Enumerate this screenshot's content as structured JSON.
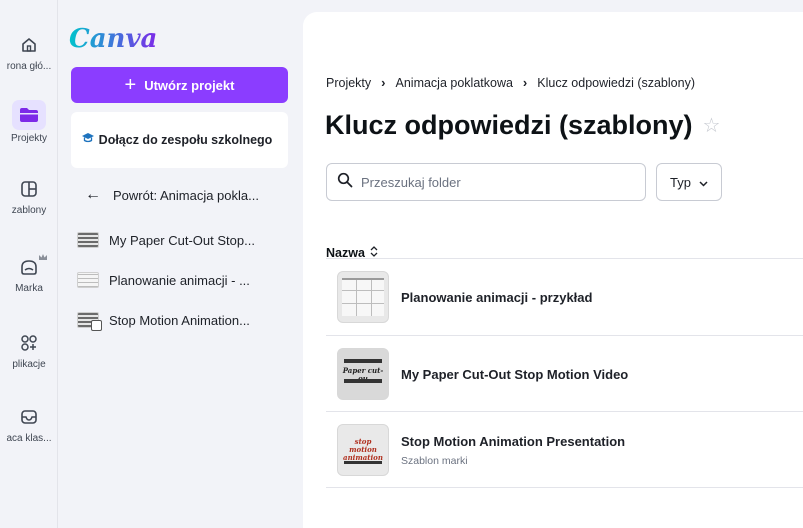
{
  "rail": {
    "items": [
      {
        "label": "rona głó...",
        "icon": "home-icon"
      },
      {
        "label": "Projekty",
        "icon": "folder-icon"
      },
      {
        "label": "zablony",
        "icon": "template-icon"
      },
      {
        "label": "Marka",
        "icon": "brand-icon"
      },
      {
        "label": "plikacje",
        "icon": "apps-icon"
      },
      {
        "label": "aca klas...",
        "icon": "classwork-icon"
      }
    ]
  },
  "sidebar": {
    "logo": "Canva",
    "create_button": "Utwórz projekt",
    "join_card": "Dołącz do zespołu szkolnego",
    "back_link": "Powrót: Animacja pokla...",
    "projects": [
      {
        "label": "My Paper Cut-Out Stop..."
      },
      {
        "label": "Planowanie animacji - ..."
      },
      {
        "label": "Stop Motion Animation..."
      }
    ]
  },
  "breadcrumb": [
    "Projekty",
    "Animacja poklatkowa",
    "Klucz odpowiedzi (szablony)"
  ],
  "page_title": "Klucz odpowiedzi (szablony)",
  "search": {
    "placeholder": "Przeszukaj folder"
  },
  "type_filter": "Typ",
  "column_header": "Nazwa",
  "files": [
    {
      "name": "Planowanie animacji - przykład",
      "subtitle": ""
    },
    {
      "name": "My Paper Cut-Out Stop Motion Video",
      "subtitle": "",
      "thumb_text": "Paper cut-ou"
    },
    {
      "name": "Stop Motion Animation Presentation",
      "subtitle": "Szablon marki",
      "thumb_text": "stop motion animation"
    }
  ],
  "colors": {
    "accent": "#8b3dff",
    "active_bg": "#e6e1ff"
  }
}
